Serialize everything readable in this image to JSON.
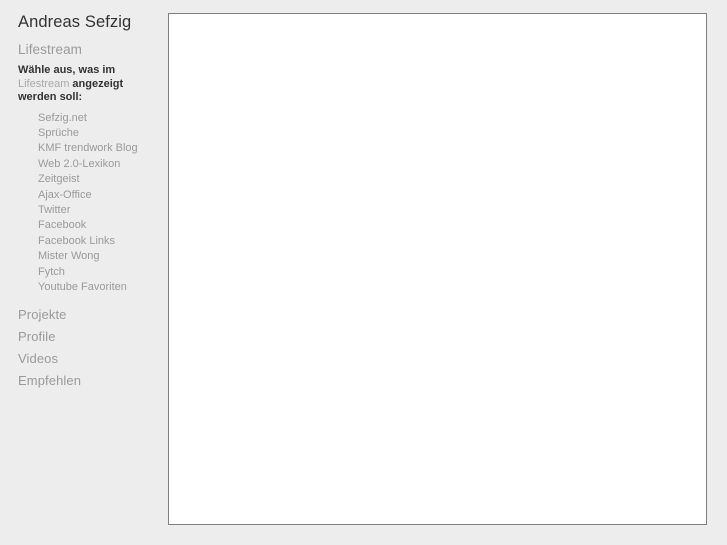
{
  "site": {
    "title": "Andreas Sefzig"
  },
  "sidebar": {
    "section_heading": "Lifestream",
    "intro": {
      "bold_before": "Wähle aus, was im ",
      "muted_word": "Lifestream",
      "bold_after": " angezeigt werden soll:"
    },
    "feed_sources": [
      {
        "label": "Sefzig.net"
      },
      {
        "label": "Sprüche"
      },
      {
        "label": "KMF trendwork Blog"
      },
      {
        "label": "Web 2.0-Lexikon"
      },
      {
        "label": "Zeitgeist"
      },
      {
        "label": "Ajax-Office"
      },
      {
        "label": "Twitter"
      },
      {
        "label": "Facebook"
      },
      {
        "label": "Facebook Links"
      },
      {
        "label": "Mister Wong"
      },
      {
        "label": "Fytch"
      },
      {
        "label": "Youtube Favoriten"
      }
    ],
    "nav_items": [
      {
        "label": "Projekte"
      },
      {
        "label": "Profile"
      },
      {
        "label": "Videos"
      },
      {
        "label": "Empfehlen"
      }
    ]
  },
  "content": {
    "body_text": ""
  },
  "colors": {
    "page_background": "#ededed",
    "panel_background": "#ffffff",
    "panel_border": "#808080",
    "title_text": "#333333",
    "muted_text": "#9a9a9a",
    "body_text": "#333333"
  }
}
